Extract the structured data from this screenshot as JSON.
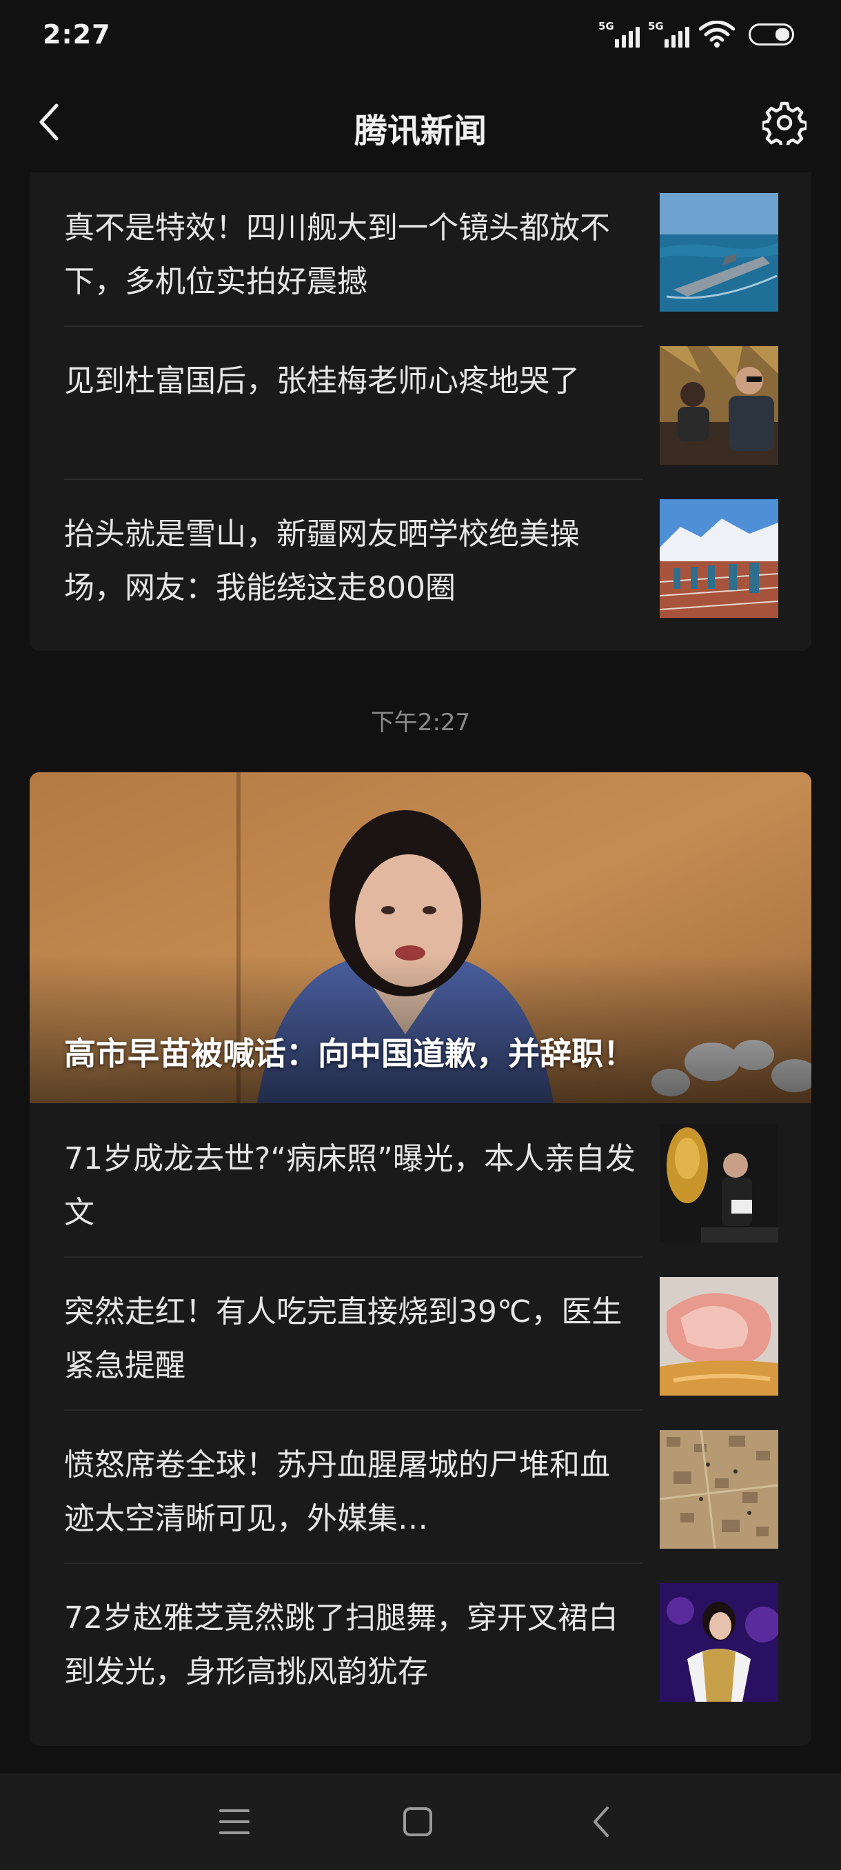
{
  "status_bar": {
    "time": "2:27",
    "sim1_tag": "5G",
    "sim2_tag": "5G"
  },
  "app_bar": {
    "title": "腾讯新闻"
  },
  "top_card": {
    "items": [
      {
        "title": "真不是特效！四川舰大到一个镜头都放不下，多机位实拍好震撼",
        "thumb": "aircraft-carrier-photo"
      },
      {
        "title": "见到杜富国后，张桂梅老师心疼地哭了",
        "thumb": "two-people-meeting-photo"
      },
      {
        "title": "抬头就是雪山，新疆网友晒学校绝美操场，网友：我能绕这走800圈",
        "thumb": "snow-mountain-playground-photo"
      }
    ]
  },
  "time_label": "下午2:27",
  "bottom_card": {
    "hero": {
      "title": "高市早苗被喊话：向中国道歉，并辞职！",
      "image": "press-conference-photo"
    },
    "items": [
      {
        "title": "71岁成龙去世?“病床照”曝光，本人亲自发文",
        "thumb": "award-stage-photo"
      },
      {
        "title": "突然走红！有人吃完直接烧到39℃，医生紧急提醒",
        "thumb": "food-closeup-photo"
      },
      {
        "title": "愤怒席卷全球！苏丹血腥屠城的尸堆和血迹太空清晰可见，外媒集…",
        "thumb": "satellite-image-photo"
      },
      {
        "title": "72岁赵雅芝竟然跳了扫腿舞，穿开叉裙白到发光，身形高挑风韵犹存",
        "thumb": "singer-stage-photo"
      }
    ]
  },
  "colors": {
    "background": "#111111",
    "card": "#1a1a1a",
    "text": "#e6e6e6",
    "muted": "#8a8a8a"
  }
}
